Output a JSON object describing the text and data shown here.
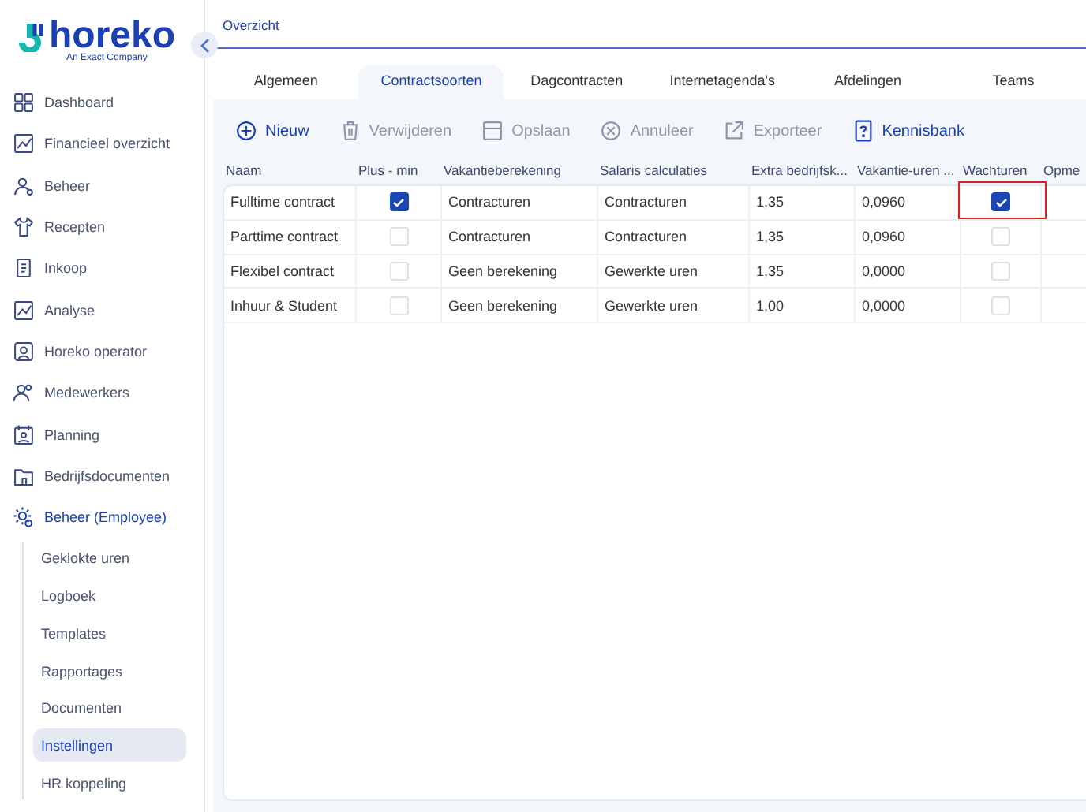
{
  "logo": {
    "name": "horeko",
    "tagline": "An Exact Company"
  },
  "sidebar": {
    "items": [
      {
        "label": "Dashboard",
        "selected": false
      },
      {
        "label": "Financieel overzicht",
        "selected": false
      },
      {
        "label": "Beheer",
        "selected": false
      },
      {
        "label": "Recepten",
        "selected": false
      },
      {
        "label": "Inkoop",
        "selected": false
      },
      {
        "label": "Analyse",
        "selected": false
      },
      {
        "label": "Horeko operator",
        "selected": false
      },
      {
        "label": "Medewerkers",
        "selected": false
      },
      {
        "label": "Planning",
        "selected": false
      },
      {
        "label": "Bedrijfsdocumenten",
        "selected": false
      },
      {
        "label": "Beheer (Employee)",
        "selected": true,
        "children": [
          {
            "label": "Geklokte uren",
            "selected": false
          },
          {
            "label": "Logboek",
            "selected": false
          },
          {
            "label": "Templates",
            "selected": false
          },
          {
            "label": "Rapportages",
            "selected": false
          },
          {
            "label": "Documenten",
            "selected": false
          },
          {
            "label": "Instellingen",
            "selected": true
          },
          {
            "label": "HR koppeling",
            "selected": false
          }
        ]
      }
    ]
  },
  "breadcrumb": "Overzicht",
  "tabs": [
    {
      "label": "Algemeen",
      "selected": false
    },
    {
      "label": "Contractsoorten",
      "selected": true
    },
    {
      "label": "Dagcontracten",
      "selected": false
    },
    {
      "label": "Internetagenda's",
      "selected": false
    },
    {
      "label": "Afdelingen",
      "selected": false
    },
    {
      "label": "Teams",
      "selected": false
    }
  ],
  "toolbar": [
    {
      "label": "Nieuw",
      "disabled": false
    },
    {
      "label": "Verwijderen",
      "disabled": true
    },
    {
      "label": "Opslaan",
      "disabled": true
    },
    {
      "label": "Annuleer",
      "disabled": true
    },
    {
      "label": "Exporteer",
      "disabled": true
    },
    {
      "label": "Kennisbank",
      "disabled": false
    }
  ],
  "table": {
    "columns": [
      "Naam",
      "Plus - min",
      "Vakantieberekening",
      "Salaris calculaties",
      "Extra bedrijfsk...",
      "Vakantie-uren ...",
      "Wachturen",
      "Opme"
    ],
    "rows": [
      {
        "naam": "Fulltime contract",
        "plus_min": true,
        "vakantieberekening": "Contracturen",
        "salaris": "Contracturen",
        "extra": "1,35",
        "vakantie_uren": "0,0960",
        "wachturen": true,
        "wachturen_highlighted": true
      },
      {
        "naam": "Parttime contract",
        "plus_min": false,
        "vakantieberekening": "Contracturen",
        "salaris": "Contracturen",
        "extra": "1,35",
        "vakantie_uren": "0,0960",
        "wachturen": false,
        "wachturen_highlighted": false
      },
      {
        "naam": "Flexibel contract",
        "plus_min": false,
        "vakantieberekening": "Geen berekening",
        "salaris": "Gewerkte uren",
        "extra": "1,35",
        "vakantie_uren": "0,0000",
        "wachturen": false,
        "wachturen_highlighted": false
      },
      {
        "naam": "Inhuur & Student",
        "plus_min": false,
        "vakantieberekening": "Geen berekening",
        "salaris": "Gewerkte uren",
        "extra": "1,00",
        "vakantie_uren": "0,0000",
        "wachturen": false,
        "wachturen_highlighted": false
      }
    ]
  }
}
